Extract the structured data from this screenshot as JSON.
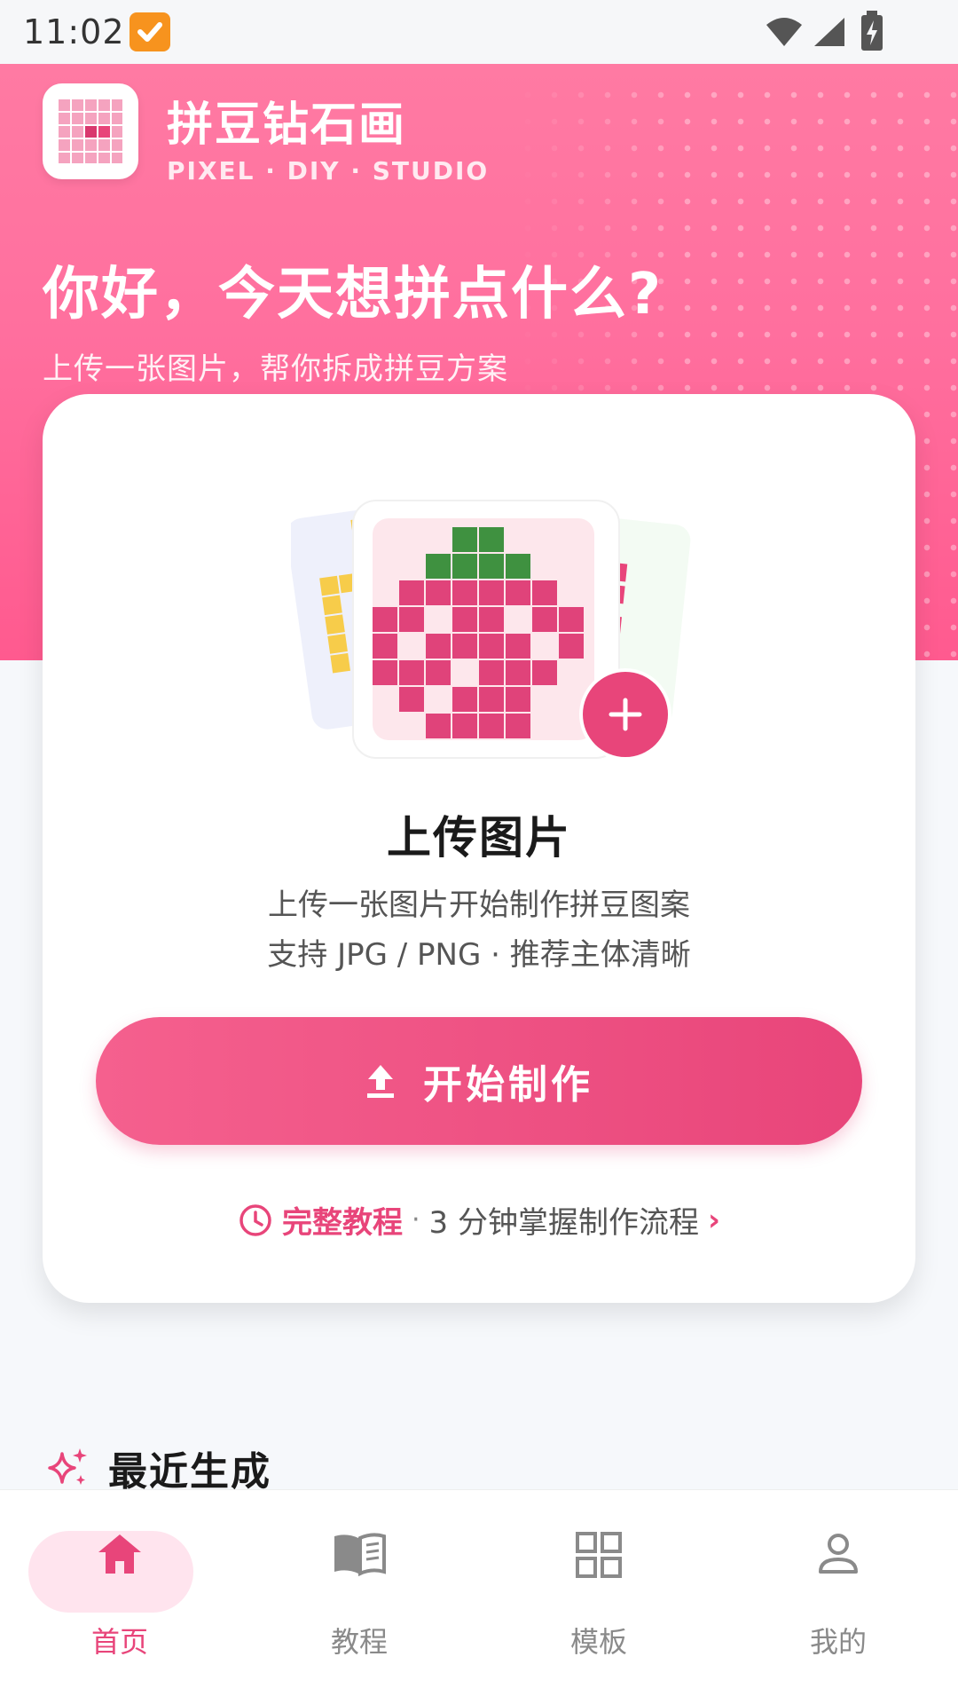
{
  "status_bar": {
    "time": "11:02"
  },
  "header": {
    "app_name": "拼豆钻石画",
    "app_subtitle": "PIXEL · DIY · STUDIO",
    "greeting": "你好，今天想拼点什么?",
    "greeting_sub": "上传一张图片，帮你拆成拼豆方案"
  },
  "upload_card": {
    "title": "上传图片",
    "desc_line1": "上传一张图片开始制作拼豆图案",
    "desc_line2": "支持 JPG / PNG · 推荐主体清晰",
    "button_label": "开始制作",
    "tutorial_strong": "完整教程",
    "tutorial_sep": "·",
    "tutorial_rest": "3 分钟掌握制作流程",
    "tutorial_chevron": "›"
  },
  "recent": {
    "title": "最近生成"
  },
  "bottom_nav": {
    "items": [
      {
        "label": "首页",
        "icon": "home-icon",
        "active": true
      },
      {
        "label": "教程",
        "icon": "book-icon",
        "active": false
      },
      {
        "label": "模板",
        "icon": "grid-icon",
        "active": false
      },
      {
        "label": "我的",
        "icon": "person-icon",
        "active": false
      }
    ]
  },
  "colors": {
    "accent": "#e8457a",
    "hero_pink": "#ff6f9e",
    "leaf_green": "#3f9140"
  }
}
